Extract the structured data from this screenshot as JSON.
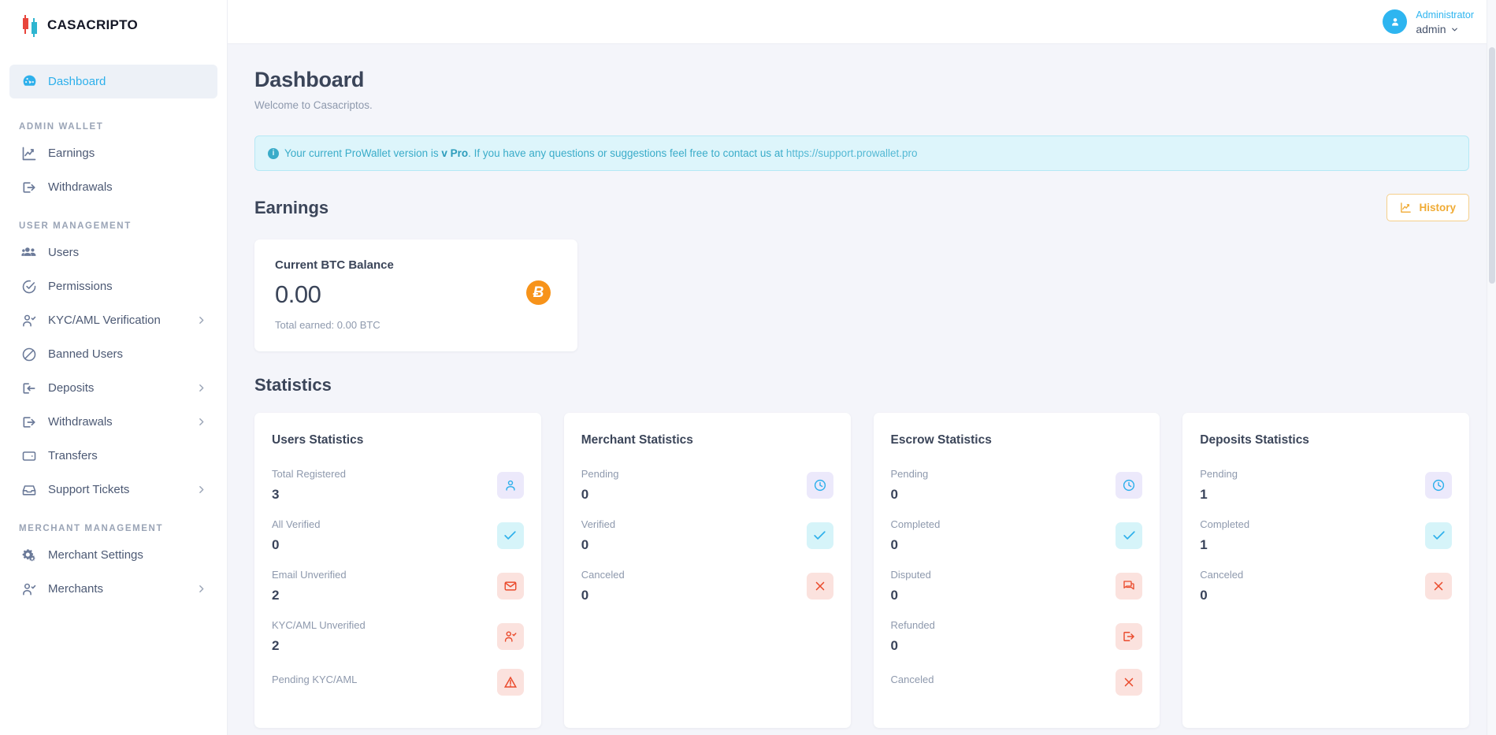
{
  "brand": {
    "name": "CASACRIPTO"
  },
  "topbar": {
    "user_role": "Administrator",
    "user_name": "admin",
    "avatar_icon": "user-icon",
    "caret_icon": "chevron-down-icon"
  },
  "sidebar": {
    "active_item": "Dashboard",
    "groups": [
      {
        "label": "",
        "items": [
          {
            "label": "Dashboard",
            "icon": "dashboard-gauge-icon",
            "active": true,
            "expandable": false
          }
        ]
      },
      {
        "label": "ADMIN WALLET",
        "items": [
          {
            "label": "Earnings",
            "icon": "chart-line-up-icon",
            "active": false,
            "expandable": false
          },
          {
            "label": "Withdrawals",
            "icon": "export-arrow-icon",
            "active": false,
            "expandable": false
          }
        ]
      },
      {
        "label": "USER MANAGEMENT",
        "items": [
          {
            "label": "Users",
            "icon": "users-group-icon",
            "active": false,
            "expandable": false
          },
          {
            "label": "Permissions",
            "icon": "check-circle-icon",
            "active": false,
            "expandable": false
          },
          {
            "label": "KYC/AML Verification",
            "icon": "user-check-icon",
            "active": false,
            "expandable": true
          },
          {
            "label": "Banned Users",
            "icon": "ban-icon",
            "active": false,
            "expandable": false
          },
          {
            "label": "Deposits",
            "icon": "import-arrow-icon",
            "active": false,
            "expandable": true
          },
          {
            "label": "Withdrawals",
            "icon": "export-arrow-icon",
            "active": false,
            "expandable": true
          },
          {
            "label": "Transfers",
            "icon": "wallet-icon",
            "active": false,
            "expandable": false
          },
          {
            "label": "Support Tickets",
            "icon": "inbox-icon",
            "active": false,
            "expandable": true
          }
        ]
      },
      {
        "label": "MERCHANT MANAGEMENT",
        "items": [
          {
            "label": "Merchant Settings",
            "icon": "gears-icon",
            "active": false,
            "expandable": false
          },
          {
            "label": "Merchants",
            "icon": "user-check-icon",
            "active": false,
            "expandable": true
          }
        ]
      }
    ]
  },
  "page": {
    "title": "Dashboard",
    "subtitle": "Welcome to Casacriptos."
  },
  "alert": {
    "icon": "info-icon",
    "text_before": "Your current ProWallet version is",
    "version": "v Pro",
    "text_after": ". If you have any questions or suggestions feel free to contact us at",
    "link": "https://support.prowallet.pro"
  },
  "earnings": {
    "section_title": "Earnings",
    "history_button": "History",
    "history_icon": "chart-line-up-icon",
    "card": {
      "label": "Current BTC Balance",
      "value": "0.00",
      "note": "Total earned: 0.00 BTC",
      "badge_icon": "bitcoin-icon",
      "badge_glyph": "Ƀ",
      "badge_color": "#f7931a"
    }
  },
  "statistics": {
    "section_title": "Statistics",
    "cards": [
      {
        "title": "Users Statistics",
        "rows": [
          {
            "label": "Total Registered",
            "value": "3",
            "icon": "user-icon",
            "tone": "purple"
          },
          {
            "label": "All Verified",
            "value": "0",
            "icon": "check-icon",
            "tone": "cyan"
          },
          {
            "label": "Email Unverified",
            "value": "2",
            "icon": "envelope-icon",
            "tone": "red"
          },
          {
            "label": "KYC/AML Unverified",
            "value": "2",
            "icon": "user-check-icon",
            "tone": "red"
          },
          {
            "label": "Pending KYC/AML",
            "value": "",
            "icon": "alert-icon",
            "tone": "red"
          }
        ]
      },
      {
        "title": "Merchant Statistics",
        "rows": [
          {
            "label": "Pending",
            "value": "0",
            "icon": "clock-icon",
            "tone": "purple"
          },
          {
            "label": "Verified",
            "value": "0",
            "icon": "check-icon",
            "tone": "cyan"
          },
          {
            "label": "Canceled",
            "value": "0",
            "icon": "x-icon",
            "tone": "red"
          }
        ]
      },
      {
        "title": "Escrow Statistics",
        "rows": [
          {
            "label": "Pending",
            "value": "0",
            "icon": "clock-icon",
            "tone": "purple"
          },
          {
            "label": "Completed",
            "value": "0",
            "icon": "check-icon",
            "tone": "cyan"
          },
          {
            "label": "Disputed",
            "value": "0",
            "icon": "chat-bubbles-icon",
            "tone": "red"
          },
          {
            "label": "Refunded",
            "value": "0",
            "icon": "export-arrow-icon",
            "tone": "red"
          },
          {
            "label": "Canceled",
            "value": "",
            "icon": "x-icon",
            "tone": "red"
          }
        ]
      },
      {
        "title": "Deposits Statistics",
        "rows": [
          {
            "label": "Pending",
            "value": "1",
            "icon": "clock-icon",
            "tone": "purple"
          },
          {
            "label": "Completed",
            "value": "1",
            "icon": "check-icon",
            "tone": "cyan"
          },
          {
            "label": "Canceled",
            "value": "0",
            "icon": "x-icon",
            "tone": "red"
          }
        ]
      }
    ]
  },
  "colors": {
    "accent": "#2eb5f0",
    "bitcoin": "#f7931a",
    "history_border": "#f5cf8a",
    "history_text": "#f0ab35",
    "alert_bg": "#ddf5fb",
    "alert_text": "#3aacc9",
    "sidebar_bg": "#ffffff",
    "page_bg": "#f4f5fa"
  }
}
